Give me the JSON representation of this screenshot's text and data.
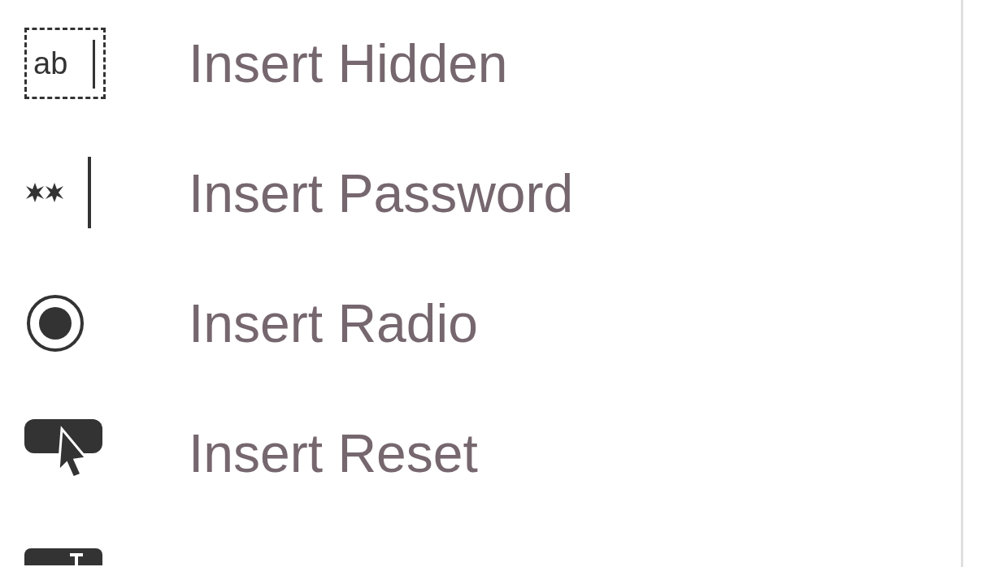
{
  "menu": {
    "items": [
      {
        "kind": "hidden",
        "label": "Insert Hidden",
        "icon_text": "ab"
      },
      {
        "kind": "password",
        "label": "Insert Password"
      },
      {
        "kind": "radio",
        "label": "Insert Radio"
      },
      {
        "kind": "reset",
        "label": "Insert Reset"
      },
      {
        "kind": "submit"
      }
    ]
  }
}
